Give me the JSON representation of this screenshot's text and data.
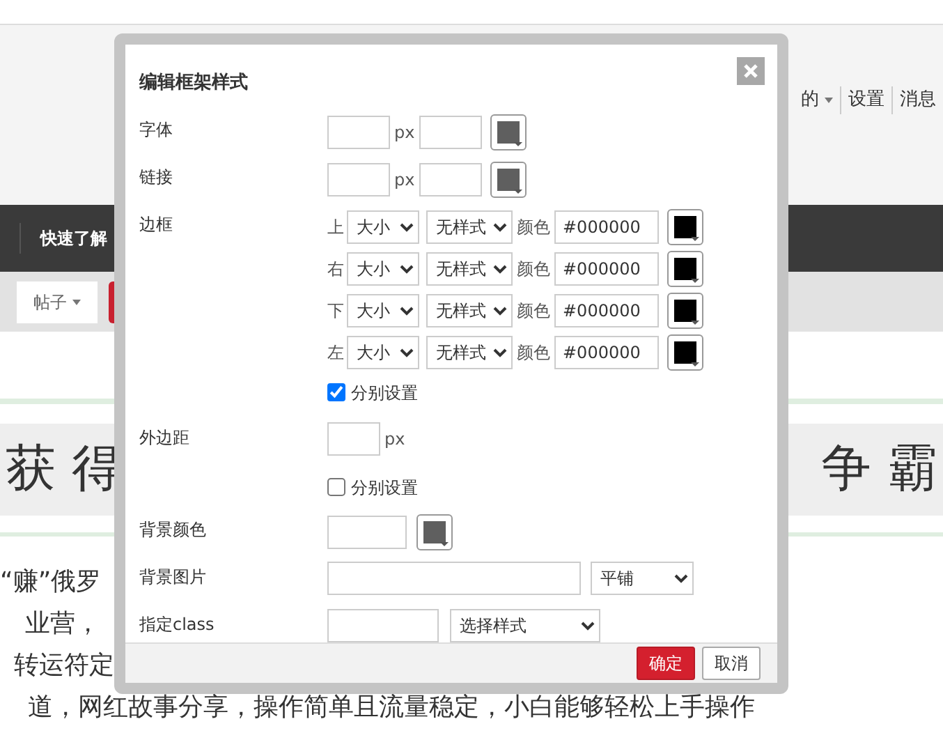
{
  "page": {
    "user_menu": [
      {
        "label": "的",
        "caret": true
      },
      {
        "label": "设置",
        "caret": false
      },
      {
        "label": "消息",
        "caret": false
      }
    ],
    "nav": {
      "label": "快速了解"
    },
    "toolbar": {
      "posts_label": "帖子",
      "caret": true
    },
    "banner": {
      "left": "获 得",
      "right": "争 霸"
    },
    "body_lines": [
      "“赚”俄罗",
      "业营，",
      "转运符定",
      "道，网红故事分享，操作简单且流量稳定，小白能够轻松上手操作"
    ]
  },
  "dialog": {
    "title": "编辑框架样式",
    "font": {
      "label": "字体",
      "unit": "px",
      "color": "#5f5f5f"
    },
    "link": {
      "label": "链接",
      "unit": "px",
      "color": "#5f5f5f"
    },
    "border": {
      "label": "边框",
      "sides": [
        {
          "side": "上",
          "size": "大小",
          "style": "无样式",
          "color_label": "颜色",
          "color_value": "#000000",
          "color": "#000000"
        },
        {
          "side": "右",
          "size": "大小",
          "style": "无样式",
          "color_label": "颜色",
          "color_value": "#000000",
          "color": "#000000"
        },
        {
          "side": "下",
          "size": "大小",
          "style": "无样式",
          "color_label": "颜色",
          "color_value": "#000000",
          "color": "#000000"
        },
        {
          "side": "左",
          "size": "大小",
          "style": "无样式",
          "color_label": "颜色",
          "color_value": "#000000",
          "color": "#000000"
        }
      ],
      "separate": {
        "label": "分别设置",
        "checked": true
      }
    },
    "margin": {
      "label": "外边距",
      "unit": "px",
      "separate": {
        "label": "分别设置",
        "checked": false
      }
    },
    "background_color": {
      "label": "背景颜色",
      "color": "#5f5f5f"
    },
    "background_image": {
      "label": "背景图片",
      "repeat": "平铺"
    },
    "css_class": {
      "label": "指定class",
      "style": "选择样式"
    },
    "buttons": [
      {
        "label": "确定",
        "kind": "primary"
      },
      {
        "label": "取消",
        "kind": "secondary"
      }
    ]
  }
}
